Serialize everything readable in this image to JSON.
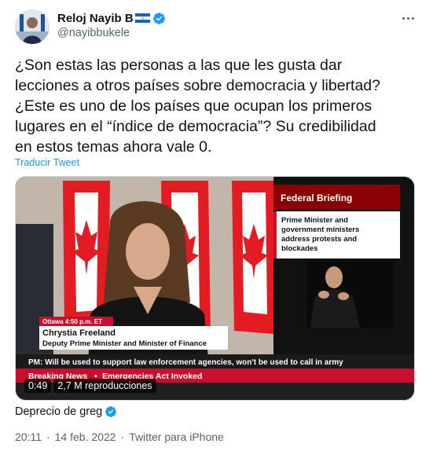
{
  "author": {
    "display_name": "Reloj Nayib B",
    "handle": "@nayibbukele",
    "verified_icon": "verified-badge-icon",
    "flag_icon": "el-salvador-flag-icon"
  },
  "menu_icon": "more-options-icon",
  "tweet": {
    "text": "¿Son estas las personas a las que les gusta dar\nlecciones a otros países sobre democracia y libertad?\n¿Este es uno de los países que ocupan los primeros\nlugares en el “índice de democracia”? Su credibilidad\nen estos temas ahora vale 0.",
    "translate_label": "Traducir Tweet"
  },
  "video": {
    "briefing_title": "Federal Briefing",
    "briefing_topic": [
      "Prime Minister and",
      "government ministers",
      "address protests and",
      "blockades"
    ],
    "location_time": "Ottawa  4:50 p.m. ET",
    "speaker_name": "Chrystia Freeland",
    "speaker_title": "Deputy Prime Minister and Minister of Finance",
    "ticker": "PM: Will be used to support law enforcement agencies, won't be used to call in army",
    "breaking_label": "Breaking News",
    "breaking_text": "Emergencies Act Invoked",
    "duration": "0:49",
    "views": "2,7 M reproducciones"
  },
  "source": {
    "prefix": "De",
    "name": "precio de greg"
  },
  "meta": {
    "time": "20:11",
    "date": "14 feb. 2022",
    "separator": "·",
    "client": "Twitter para iPhone"
  },
  "colors": {
    "link": "#1d9bf0",
    "verified": "#1d9bf0",
    "breaking_red": "#c8102e",
    "text_secondary": "#536471"
  }
}
